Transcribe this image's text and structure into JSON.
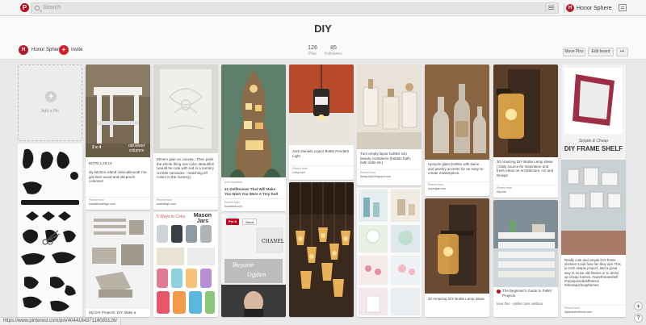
{
  "topbar": {
    "logo": "P",
    "search_placeholder": "Search",
    "user": "Honor Sphere",
    "user_initial": "H"
  },
  "header": {
    "title": "DIY",
    "owner": "Honor Sphere",
    "owner_initial": "H",
    "invite": "Invite",
    "pins_count": "126",
    "pins_label": "Pins",
    "followers_count": "85",
    "followers_label": "Followers",
    "move_pins": "Move Pins",
    "edit_board": "Edit board",
    "more": "•••"
  },
  "add_pin": {
    "label": "Add a Pin"
  },
  "pins": {
    "p1": {
      "overlay": "2 x 4",
      "overlay2": "old wood columns",
      "caption": "BOTB 1.29.14\n\ndiy kitchen island rationaliinood! I've got barn wood and old porch columns!",
      "src_label": "Pinned from",
      "src": "sandiaboldesign.com"
    },
    "p2": {
      "caption": "Elmers glue on canvas.. Then paint the whole thing one color. Beautiful! (would be cute with red in a nursery on little canvases - matching elf colors in the nursery)",
      "src_label": "Pinned from",
      "src": "karenleigh.com"
    },
    "p3": {
      "caption": "41 Dollhouses That Will Make You Wish You Were A Tiny Doll",
      "src_label": "Pinned from",
      "src": "buzzfeed.com",
      "via": "from buzzfeed"
    },
    "p4": {
      "caption": "Jack Daniels Liquor Bottle Pendant Light",
      "src_label": "Pinned from",
      "src": "r-etsy.com"
    },
    "p5": {
      "caption": "Turn empty liquor bottles into beauty containers (bubble bath, bath salts etc)",
      "src_label": "Pinned from",
      "src": "ifancy-diys.blogspot.com"
    },
    "p6": {
      "caption": "Upcycle glass bottles with twine and jewelry accents for an easy-to-create masterpiece.",
      "src_label": "Pinned from",
      "src": "popsugar.com"
    },
    "p7": {
      "caption": "30 Amazing DIY Bottle Lamp Ideas | Daily source for inspiration and fresh ideas on Architecture, Art and Design",
      "src_label": "Pinned from",
      "src": "ebj.com"
    },
    "p8": {
      "overlay": "Simple & Cheap",
      "overlay2": "DIY FRAME SHELF",
      "caption": "Really cute and simple DIY frame shelves! Look how fun they are! This is such simple project, and a great way to reuse old frames or to dress up cheap frames. #cutefrrameshelf #repurposedoldframes #dressupcheapframes",
      "src_label": "Pinned from",
      "src": "diybeautifulhome.com"
    },
    "p9": {
      "title": "5 Ways to Color",
      "title2": "Mason Jars"
    },
    "p10": {
      "save": "Send",
      "pin_it": "Pin it",
      "text1": "Beyone",
      "text2": "Ogden"
    },
    "p11": {
      "caption": "My DIY Projects: DIY Make a"
    },
    "p12": {
      "caption": "30 Amazing DIY Bottle Lamp Ideas"
    },
    "p13": {
      "caption": "The Beginner's Guide to Pallet Projects",
      "caption2": "love this - pallet cute outdoor"
    }
  },
  "status_url": "https://www.pinterest.com/pin/404418437116083126/",
  "colors": {
    "brand": "#bd081c",
    "bg": "#e9e9e9"
  }
}
